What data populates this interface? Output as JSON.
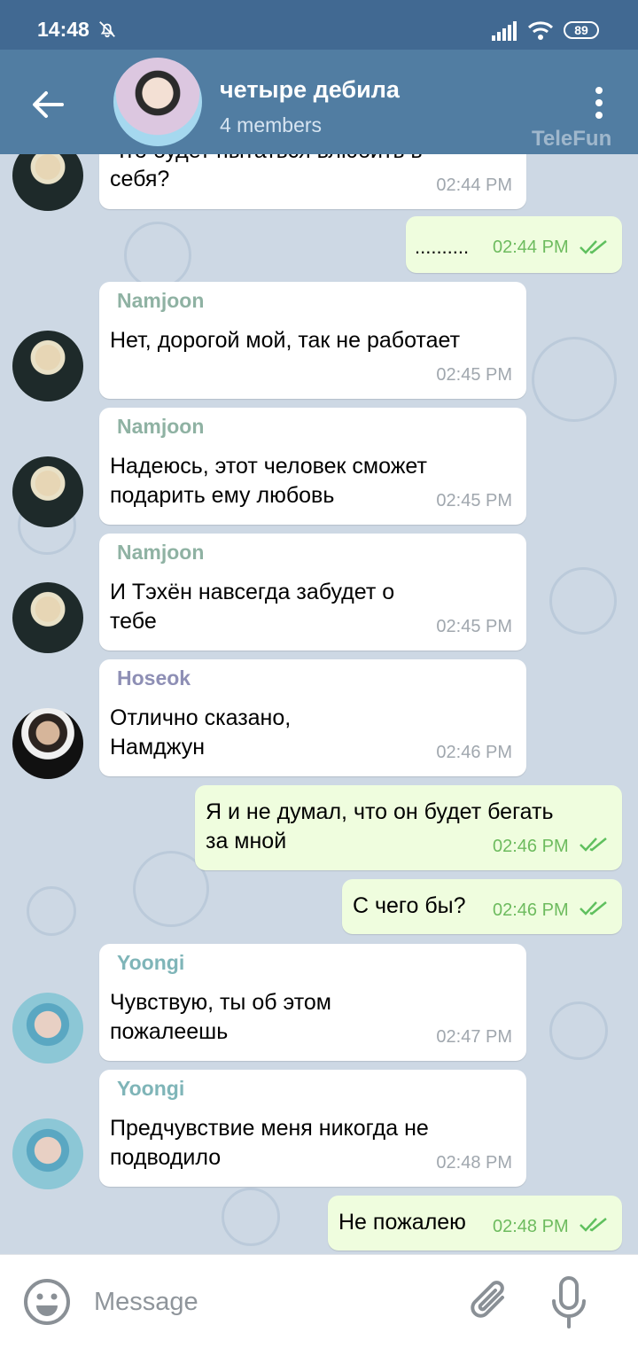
{
  "status_bar": {
    "time": "14:48",
    "battery": "89"
  },
  "header": {
    "title": "четыре дебила",
    "subtitle": "4 members",
    "watermark": "TeleFun"
  },
  "messages": [
    {
      "sender": "",
      "text": "Что будет пытаться влюбить в себя?",
      "visible_text": "себя?",
      "time": "02:44 PM",
      "outgoing": false
    },
    {
      "sender": "",
      "text": "..........",
      "time": "02:44 PM",
      "outgoing": true
    },
    {
      "sender": "Namjoon",
      "text": "Нет, дорогой мой, так не работает",
      "time": "02:45 PM",
      "outgoing": false
    },
    {
      "sender": "Namjoon",
      "line1": "Надеюсь, этот человек сможет",
      "line2": "подарить ему любовь",
      "time": "02:45 PM",
      "outgoing": false
    },
    {
      "sender": "Namjoon",
      "line1": "И Тэхён навсегда забудет о",
      "line2": "тебе",
      "time": "02:45 PM",
      "outgoing": false
    },
    {
      "sender": "Hoseok",
      "line1": "Отлично сказано,",
      "line2": "Намджун",
      "time": "02:46 PM",
      "outgoing": false
    },
    {
      "sender": "",
      "line1": "Я и не думал, что он будет бегать",
      "line2": "за мной",
      "time": "02:46 PM",
      "outgoing": true
    },
    {
      "sender": "",
      "text": "С чего бы?",
      "time": "02:46 PM",
      "outgoing": true
    },
    {
      "sender": "Yoongi",
      "line1": "Чувствую, ты об этом",
      "line2": "пожалеешь",
      "time": "02:47 PM",
      "outgoing": false
    },
    {
      "sender": "Yoongi",
      "line1": "Предчувствие меня никогда не",
      "line2": "подводило",
      "time": "02:48 PM",
      "outgoing": false
    },
    {
      "sender": "",
      "text": "Не пожалею",
      "time": "02:48 PM",
      "outgoing": true
    }
  ],
  "colors": {
    "namjoon": "#8fb2a3",
    "hoseok": "#8e8fb5",
    "yoongi": "#7fb5b8",
    "header": "#517da2",
    "outgoing_bubble": "#effdde"
  },
  "input": {
    "placeholder": "Message"
  }
}
